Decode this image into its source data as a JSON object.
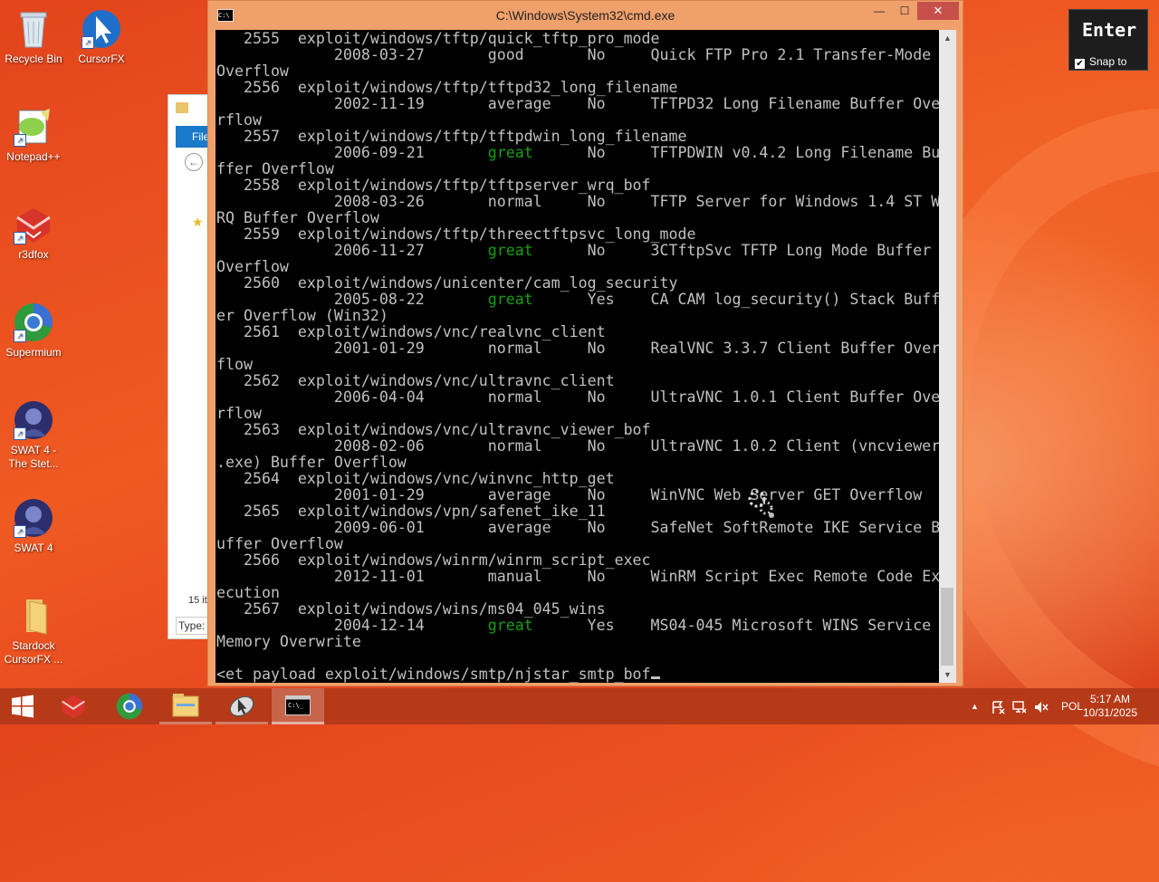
{
  "desktop": {
    "icons": [
      {
        "label": "Recycle Bin"
      },
      {
        "label": "CursorFX"
      },
      {
        "label": "Notepad++"
      },
      {
        "label": "r3dfox"
      },
      {
        "label": "Supermium"
      },
      {
        "label": "SWAT 4 - The Stet..."
      },
      {
        "label": "SWAT 4"
      },
      {
        "label": "Stardock CursorFX ..."
      }
    ]
  },
  "explorer": {
    "ribbon_tab": "File",
    "status": "15 it",
    "type_label": "Type:"
  },
  "cmd": {
    "title": "C:\\Windows\\System32\\cmd.exe",
    "minimize": "—",
    "maximize": "☐",
    "close": "✕",
    "lines": [
      {
        "t": "   2555  exploit/windows/tftp/quick_tftp_pro_mode"
      },
      {
        "t": "             2008-03-27       good       No     Quick FTP Pro 2.1 Transfer-Mode "
      },
      {
        "t": "Overflow"
      },
      {
        "t": "   2556  exploit/windows/tftp/tftpd32_long_filename"
      },
      {
        "t": "             2002-11-19       average    No     TFTPD32 Long Filename Buffer Ove"
      },
      {
        "t": "rflow"
      },
      {
        "t": "   2557  exploit/windows/tftp/tftpdwin_long_filename"
      },
      {
        "pre": "             2006-09-21       ",
        "g": "great",
        "post": "      No     TFTPDWIN v0.4.2 Long Filename Bu"
      },
      {
        "t": "ffer Overflow"
      },
      {
        "t": "   2558  exploit/windows/tftp/tftpserver_wrq_bof"
      },
      {
        "t": "             2008-03-26       normal     No     TFTP Server for Windows 1.4 ST W"
      },
      {
        "t": "RQ Buffer Overflow"
      },
      {
        "t": "   2559  exploit/windows/tftp/threectftpsvc_long_mode"
      },
      {
        "pre": "             2006-11-27       ",
        "g": "great",
        "post": "      No     3CTftpSvc TFTP Long Mode Buffer "
      },
      {
        "t": "Overflow"
      },
      {
        "t": "   2560  exploit/windows/unicenter/cam_log_security"
      },
      {
        "pre": "             2005-08-22       ",
        "g": "great",
        "post": "      Yes    CA CAM log_security() Stack Buff"
      },
      {
        "t": "er Overflow (Win32)"
      },
      {
        "t": "   2561  exploit/windows/vnc/realvnc_client"
      },
      {
        "t": "             2001-01-29       normal     No     RealVNC 3.3.7 Client Buffer Over"
      },
      {
        "t": "flow"
      },
      {
        "t": "   2562  exploit/windows/vnc/ultravnc_client"
      },
      {
        "t": "             2006-04-04       normal     No     UltraVNC 1.0.1 Client Buffer Ove"
      },
      {
        "t": "rflow"
      },
      {
        "t": "   2563  exploit/windows/vnc/ultravnc_viewer_bof"
      },
      {
        "t": "             2008-02-06       normal     No     UltraVNC 1.0.2 Client (vncviewer"
      },
      {
        "t": ".exe) Buffer Overflow"
      },
      {
        "t": "   2564  exploit/windows/vnc/winvnc_http_get"
      },
      {
        "t": "             2001-01-29       average    No     WinVNC Web Server GET Overflow"
      },
      {
        "t": "   2565  exploit/windows/vpn/safenet_ike_11"
      },
      {
        "t": "             2009-06-01       average    No     SafeNet SoftRemote IKE Service B"
      },
      {
        "t": "uffer Overflow"
      },
      {
        "t": "   2566  exploit/windows/winrm/winrm_script_exec"
      },
      {
        "t": "             2012-11-01       manual     No     WinRM Script Exec Remote Code Ex"
      },
      {
        "t": "ecution"
      },
      {
        "t": "   2567  exploit/windows/wins/ms04_045_wins"
      },
      {
        "pre": "             2004-12-14       ",
        "g": "great",
        "post": "      Yes    MS04-045 Microsoft WINS Service "
      },
      {
        "t": "Memory Overwrite"
      },
      {
        "t": ""
      },
      {
        "t": "<et payload exploit/windows/smtp/njstar_smtp_bof"
      }
    ]
  },
  "key_overlay": {
    "key": "Enter",
    "snap_label": "Snap to",
    "snap_checked": "✔"
  },
  "tray": {
    "lang": "POL",
    "time": "5:17 AM",
    "date": "10/31/2025",
    "up_arrow": "▲"
  },
  "colors": {
    "desktop": "#e8491f",
    "taskbar": "#b63a18",
    "console_text": "#c0c0c0",
    "console_green": "#13a10e",
    "close_button": "#c7514a"
  }
}
